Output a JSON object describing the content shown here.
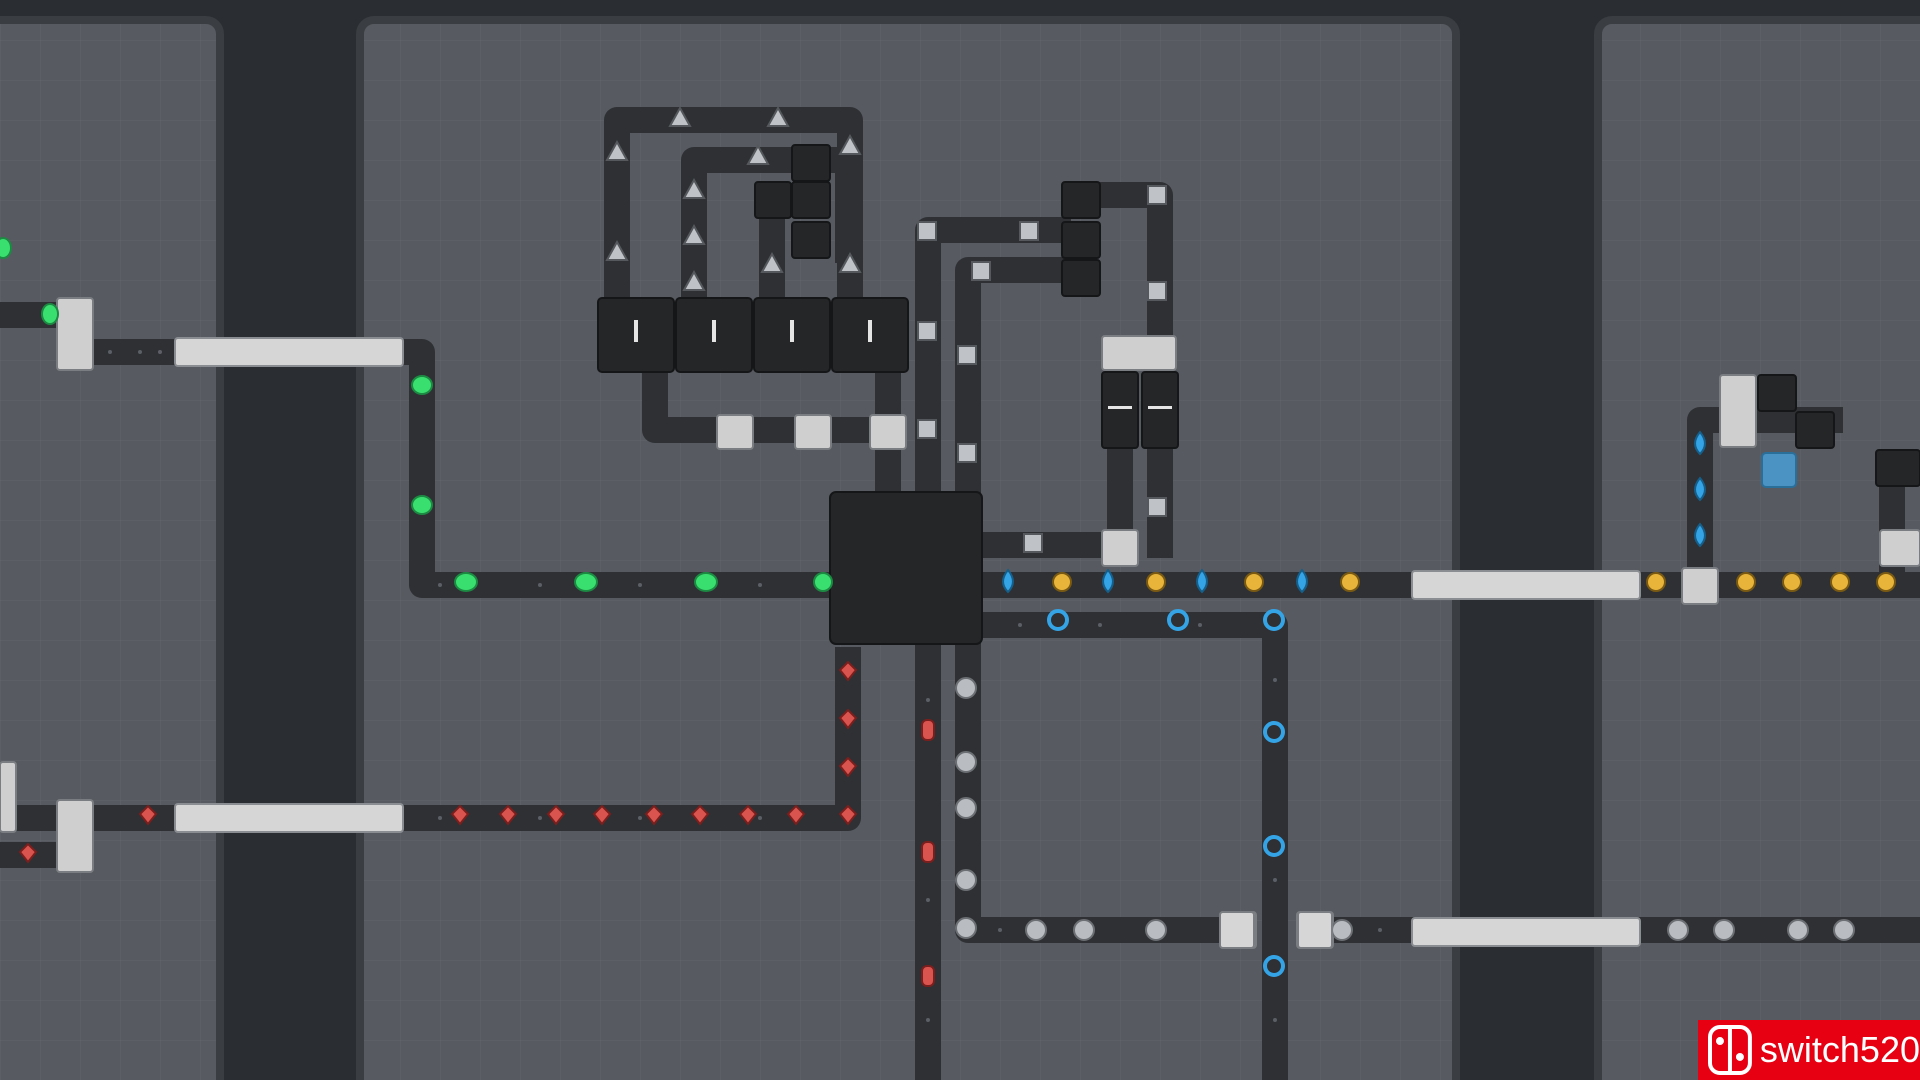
{
  "watermark": {
    "text": "switch520",
    "logo_icon": "nintendo-switch-logo-icon",
    "color": "#e60012"
  },
  "theme": {
    "background": "#2a2d31",
    "zone_fill": "#575b61",
    "zone_border": "#3a3d41",
    "belt": "#2e3034",
    "machine": "#252628",
    "connector": "#d6d6d6"
  },
  "items": {
    "green_leaf": {
      "icon": "leaf-icon",
      "color": "#39e06f"
    },
    "red_gem": {
      "icon": "gem-icon",
      "color": "#d9534f"
    },
    "blue_drop": {
      "icon": "water-drop-icon",
      "color": "#35a4e6"
    },
    "gold_bolt": {
      "icon": "lightning-bolt-icon",
      "color": "#e8b43a"
    },
    "grey_ball": {
      "icon": "ball-icon",
      "color": "#b9bcc0"
    },
    "cube": {
      "icon": "cube-icon",
      "color": "#bfc2c6"
    },
    "pyramid": {
      "icon": "pyramid-icon",
      "color": "#bfc2c6"
    }
  }
}
